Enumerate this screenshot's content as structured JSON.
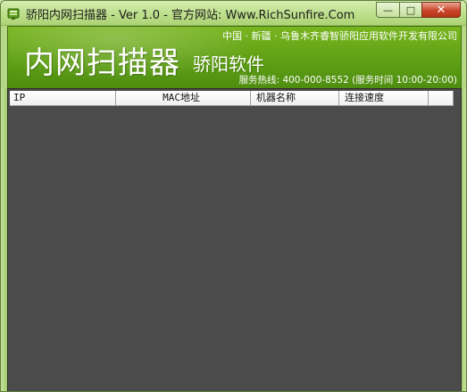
{
  "window": {
    "title": "骄阳内网扫描器 - Ver 1.0 - 官方网站: Www.RichSunfire.Com",
    "min_glyph": "—",
    "max_glyph": "□",
    "close_glyph": "✕"
  },
  "banner": {
    "company": "中国 · 新疆 · 乌鲁木齐睿智骄阳应用软件开发有限公司",
    "product": "内网扫描器",
    "brand": "骄阳软件",
    "hotline": "服务热线: 400-000-8552 (服务时间 10:00-20:00)"
  },
  "list": {
    "columns": [
      "IP",
      "MAC地址",
      "机器名称",
      "连接速度",
      ""
    ],
    "rows": []
  },
  "colors": {
    "banner_green": "#5fa015",
    "list_background": "#4b4b4b",
    "frame_green": "#b9d98a",
    "close_red": "#c9462a"
  },
  "icons": [
    "app-icon",
    "minimize-icon",
    "maximize-icon",
    "close-icon"
  ]
}
